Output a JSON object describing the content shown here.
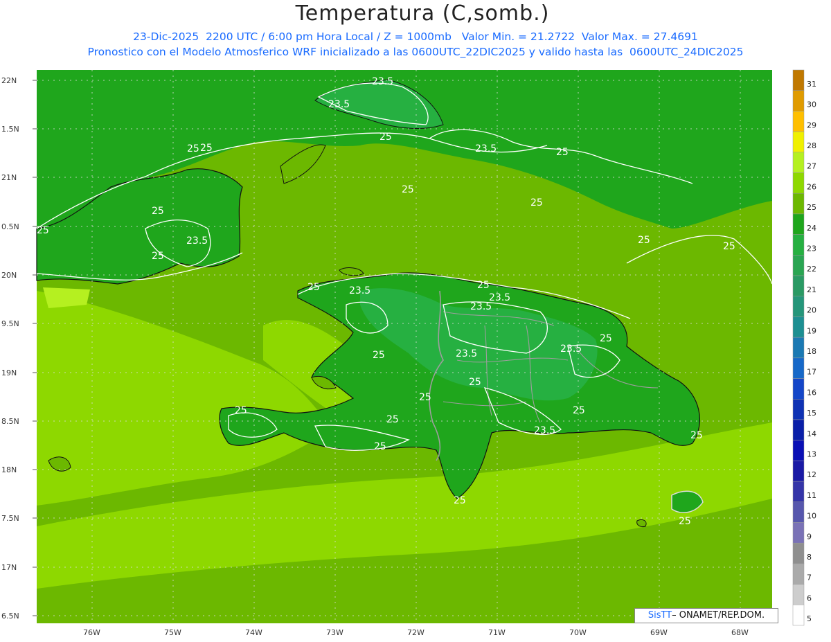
{
  "header": {
    "title": "Temperatura (C,somb.)",
    "line1": "23-Dic-2025  2200 UTC / 6:00 pm Hora Local / Z = 1000mb   Valor Min. = 21.2722  Valor Max. = 27.4691",
    "line2": "Pronostico con el Modelo Atmosferico WRF inicializado a las 0600UTC_22DIC2025 y valido hasta las  0600UTC_24DIC2025"
  },
  "axes": {
    "lat_labels": [
      "22N",
      "1.5N",
      "21N",
      "0.5N",
      "20N",
      "9.5N",
      "19N",
      "8.5N",
      "18N",
      "7.5N",
      "17N",
      "6.5N"
    ],
    "lon_labels": [
      "76W",
      "75W",
      "74W",
      "73W",
      "72W",
      "71W",
      "70W",
      "69W",
      "68W"
    ]
  },
  "colorbar": {
    "levels": [
      "31",
      "30",
      "29",
      "28",
      "27",
      "26",
      "25",
      "24",
      "23",
      "22",
      "21",
      "20",
      "19",
      "18",
      "17",
      "16",
      "15",
      "14",
      "13",
      "12",
      "11",
      "10",
      "9",
      "8",
      "7",
      "6",
      "5"
    ],
    "colors": [
      "#c07800",
      "#e09b00",
      "#ffbf00",
      "#f0f000",
      "#b5f020",
      "#8ed800",
      "#6cb800",
      "#1fa61c",
      "#26b041",
      "#2aa552",
      "#2a9a64",
      "#25967a",
      "#1d8f92",
      "#1b79b3",
      "#1668c8",
      "#1446c8",
      "#0f32b4",
      "#0a1fa8",
      "#0a0fb5",
      "#1a1aa5",
      "#3535a8",
      "#5757ad",
      "#7a72b6",
      "#8f8f8f",
      "#aaaaaa",
      "#cdcdcd",
      "#ffffff"
    ]
  },
  "contour_labels": [
    "23.5",
    "23.5",
    "25",
    "23.5",
    "25",
    "25",
    "25",
    "25",
    "25",
    "25",
    "23.5",
    "25",
    "25",
    "25",
    "25",
    "23.5",
    "25",
    "23.5",
    "23.5",
    "23.5",
    "25",
    "25",
    "23.5",
    "25",
    "25",
    "25",
    "25",
    "25",
    "25",
    "23.5",
    "25",
    "25",
    "25",
    "25"
  ],
  "credit": {
    "brand": "SisTT",
    "text": " ONAMET/REP.DOM."
  },
  "colors": {
    "ocean": "#6cb800",
    "land_main": "#1fa61c",
    "warm_sea": "#8ed800",
    "hot_spot": "#b5f020"
  }
}
